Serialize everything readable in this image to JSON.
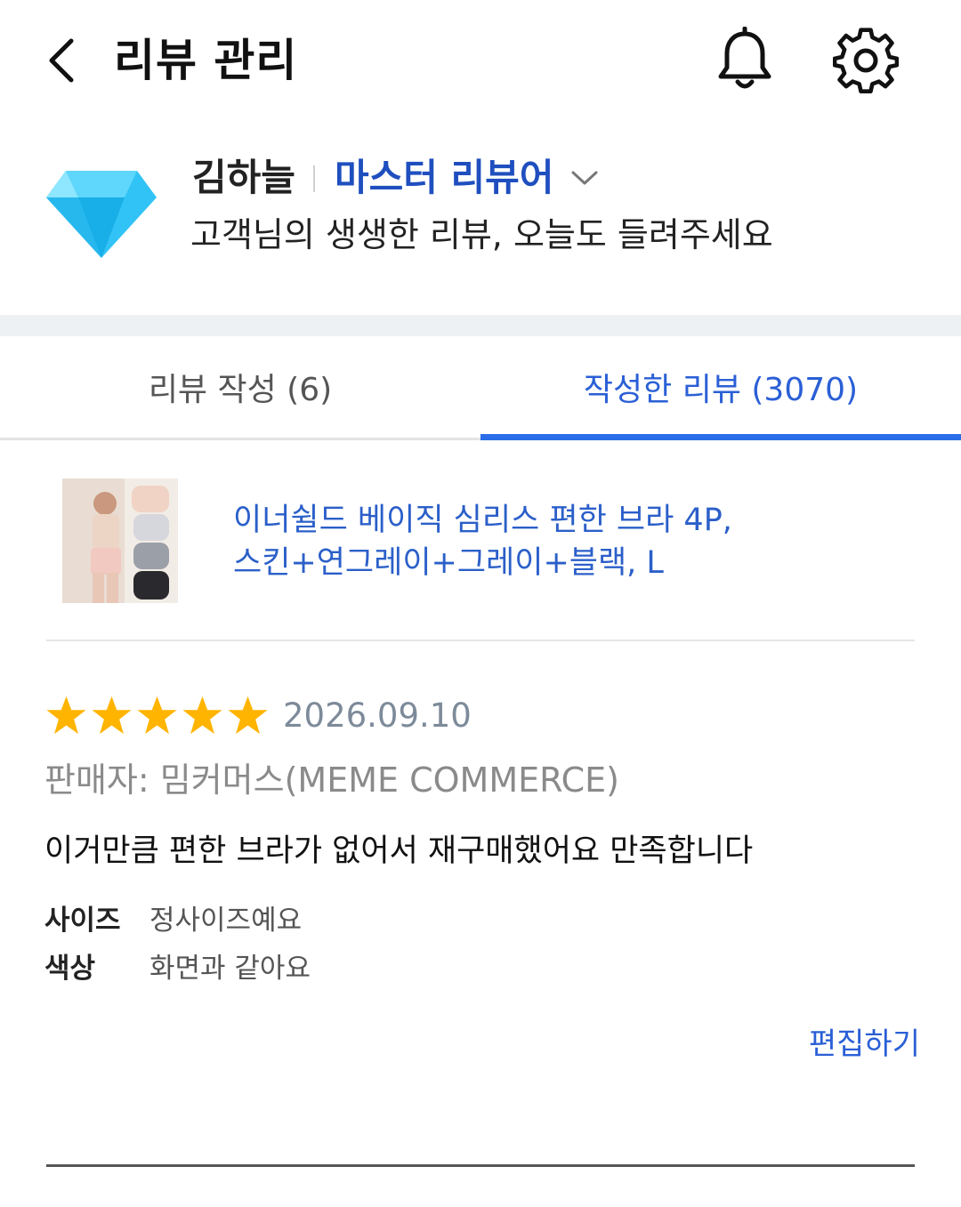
{
  "header": {
    "title": "리뷰 관리",
    "back_icon": "back-arrow-icon",
    "bell_icon": "bell-icon",
    "settings_icon": "gear-icon"
  },
  "profile": {
    "name": "김하늘",
    "grade": "마스터 리뷰어",
    "subtitle": "고객님의 생생한 리뷰, 오늘도 들려주세요",
    "badge_icon": "diamond-icon"
  },
  "tabs": [
    {
      "label": "리뷰 작성 (6)",
      "active": false
    },
    {
      "label": "작성한 리뷰 (3070)",
      "active": true
    }
  ],
  "product": {
    "title_line1": "이너쉴드 베이직 심리스 편한 브라 4P,",
    "title_line2": "스킨+연그레이+그레이+블랙, L"
  },
  "review": {
    "rating": 5,
    "date": "2026.09.10",
    "seller": "판매자: 밈커머스(MEME COMMERCE)",
    "content": "이거만큼 편한 브라가 없어서 재구매했어요 만족합니다",
    "attributes": [
      {
        "label": "사이즈",
        "value": "정사이즈예요"
      },
      {
        "label": "색상",
        "value": "화면과 같아요"
      }
    ],
    "edit_label": "편집하기"
  },
  "colors": {
    "accent": "#2b6de8",
    "link": "#2a5fd6",
    "star": "#ffb400",
    "band": "#eef1f4"
  }
}
